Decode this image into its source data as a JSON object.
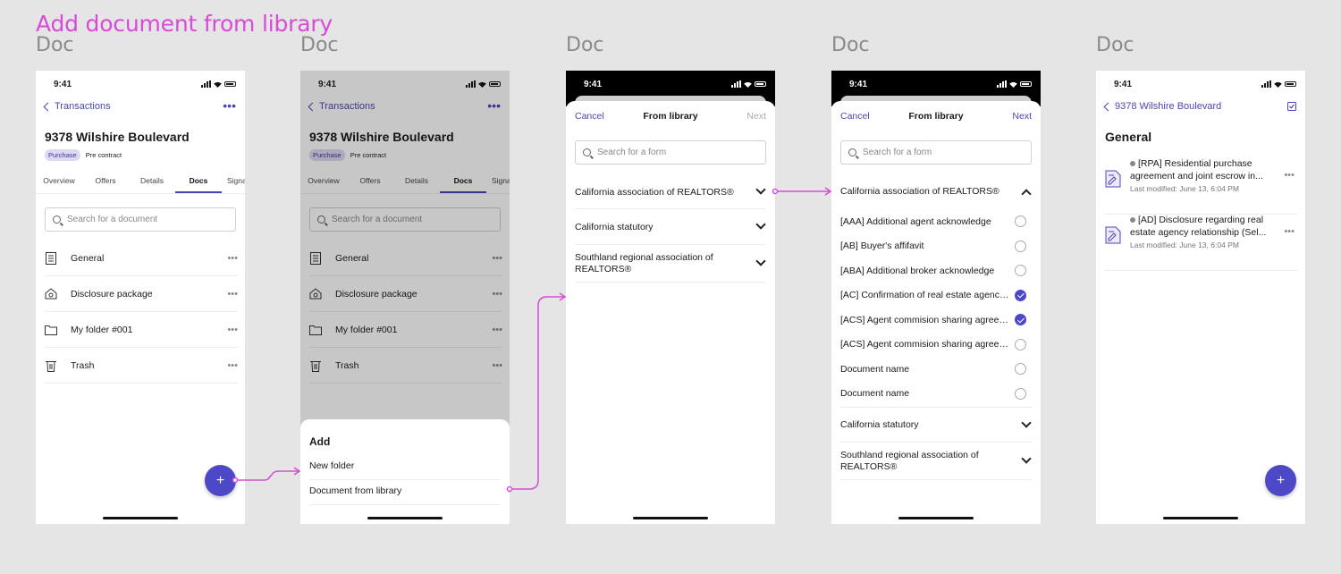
{
  "flow_title": "Add document from library",
  "frame_label": "Doc",
  "status_time": "9:41",
  "screen1": {
    "back_label": "Transactions",
    "more": "•••",
    "property": "9378 Wilshire Boulevard",
    "badge_type": "Purchase",
    "badge_stage": "Pre contract",
    "tabs": [
      "Overview",
      "Offers",
      "Details",
      "Docs",
      "Signa"
    ],
    "search_placeholder": "Search for a document",
    "folders": [
      {
        "label": "General",
        "icon": "document-list-icon"
      },
      {
        "label": "Disclosure package",
        "icon": "house-icon"
      },
      {
        "label": "My folder #001",
        "icon": "folder-icon"
      },
      {
        "label": "Trash",
        "icon": "trash-icon"
      }
    ],
    "dots": "•••",
    "fab": "+"
  },
  "screen2": {
    "sheet_title": "Add",
    "options": [
      "New folder",
      "Document from library"
    ]
  },
  "screen3": {
    "cancel": "Cancel",
    "title": "From library",
    "next": "Next",
    "search_placeholder": "Search for a form",
    "groups": [
      "California association of REALTORS®",
      "California statutory",
      "Southland regional association of REALTORS®"
    ]
  },
  "screen4": {
    "cancel": "Cancel",
    "title": "From library",
    "next": "Next",
    "search_placeholder": "Search for a form",
    "expanded_group": "California association of REALTORS®",
    "forms": [
      {
        "label": "[AAA] Additional agent acknowledge",
        "checked": false
      },
      {
        "label": "[AB] Buyer's affifavit",
        "checked": false
      },
      {
        "label": "[ABA] Additional broker acknowledge",
        "checked": false
      },
      {
        "label": "[AC] Confirmation of real estate agency relationship",
        "checked": true
      },
      {
        "label": "[ACS] Agent commision sharing agreement",
        "checked": true
      },
      {
        "label": "[ACS] Agent commision sharing agreement",
        "checked": false
      },
      {
        "label": "Document name",
        "checked": false
      },
      {
        "label": "Document name",
        "checked": false
      }
    ],
    "collapsed_groups": [
      "California statutory",
      "Southland regional association of REALTORS®"
    ]
  },
  "screen5": {
    "back_label": "9378 Wilshire Boulevard",
    "section_title": "General",
    "docs": [
      {
        "title": "[RPA] Residential purchase agreement and joint escrow in...",
        "meta": "Last modified: June 13, 6:04 PM"
      },
      {
        "title": "[AD] Disclosure regarding real estate agency relationship (Sel...",
        "meta": "Last modified: June 13, 6:04 PM"
      }
    ],
    "fab": "+"
  },
  "colors": {
    "accent": "#4b44b8",
    "flow": "#d94ad9",
    "fab": "#4d48c8"
  }
}
